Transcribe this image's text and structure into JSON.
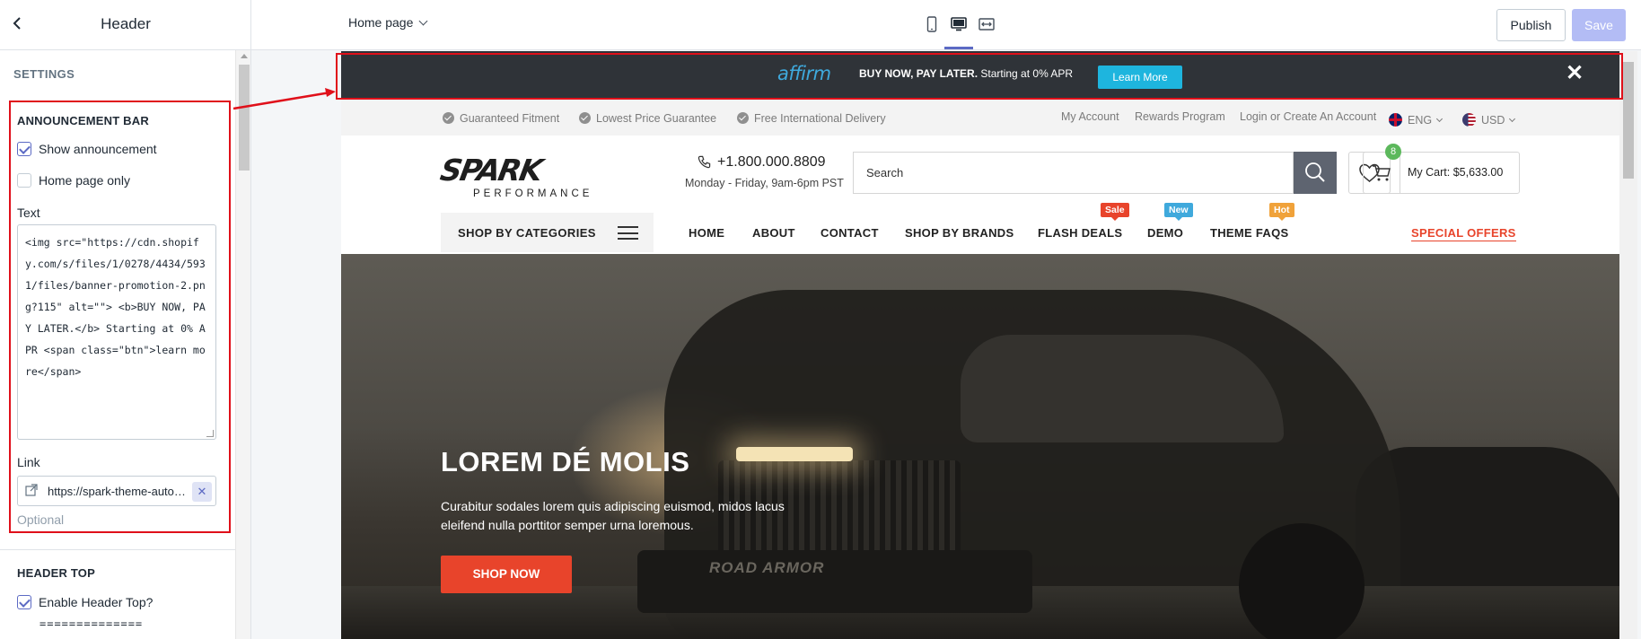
{
  "editor": {
    "sidebar": {
      "title": "Header",
      "settings_label": "SETTINGS",
      "announcement": {
        "title": "ANNOUNCEMENT BAR",
        "show_label": "Show announcement",
        "show_checked": true,
        "home_only_label": "Home page only",
        "home_only_checked": false,
        "text_label": "Text",
        "text_value": "<img src=\"https://cdn.shopify.com/s/files/1/0278/4434/5931/files/banner-promotion-2.png?115\" alt=\"\"> <b>BUY NOW, PAY LATER.</b> Starting at 0% APR <span class=\"btn\">learn more</span>",
        "link_label": "Link",
        "link_value": "https://spark-theme-automotive.myshopify.com",
        "link_help": "Optional"
      },
      "header_top": {
        "title": "HEADER TOP",
        "enable_label": "Enable Header Top?",
        "enable_checked": true,
        "separator_text": "=============="
      }
    },
    "toolbar": {
      "page_select": "Home page",
      "publish_label": "Publish",
      "save_label": "Save"
    }
  },
  "store": {
    "announcement": {
      "logo_text": "affirm",
      "bold_text": "BUY NOW, PAY LATER.",
      "rest_text": " Starting at 0% APR",
      "button_label": "Learn More",
      "close_symbol": "✕"
    },
    "header_top": {
      "left_items": [
        "Guaranteed Fitment",
        "Lowest Price Guarantee",
        "Free International Delivery"
      ],
      "links": [
        "My Account",
        "Rewards Program",
        "Login or Create An Account"
      ],
      "language": "ENG",
      "currency": "USD"
    },
    "header_main": {
      "logo_main": "SPARK",
      "logo_sub": "PERFORMANCE",
      "phone": "+1.800.000.8809",
      "hours": "Monday - Friday, 9am-6pm PST",
      "search_placeholder": "Search",
      "cart_count": "8",
      "cart_label": "My Cart: $5,633.00"
    },
    "nav": {
      "categories_label": "SHOP BY CATEGORIES",
      "items": [
        "HOME",
        "ABOUT",
        "CONTACT",
        "SHOP BY BRANDS",
        "FLASH DEALS",
        "DEMO",
        "THEME FAQS"
      ],
      "tags": [
        "Sale",
        "New",
        "Hot"
      ],
      "special": "SPECIAL OFFERS"
    },
    "hero": {
      "title": "LOREM DÉ MOLIS",
      "description": "Curabitur sodales lorem quis adipiscing euismod, midos lacus eleifend nulla porttitor semper urna loremous.",
      "button_label": "SHOP NOW",
      "bumper_text": "ROAD ARMOR"
    }
  },
  "colors": {
    "accent": "#5c6ac4",
    "highlight_border": "#e0101a",
    "announcement_bg": "#2f3338",
    "affirm_blue": "#1eb5de",
    "brand_orange": "#e8442b",
    "tag_sale": "#e8442b",
    "tag_new": "#3fa9dc",
    "tag_hot": "#f0a23a"
  },
  "icons": [
    "back-arrow-icon",
    "chevron-down-icon",
    "mobile-icon",
    "desktop-icon",
    "fullwidth-icon",
    "external-link-icon",
    "clear-icon",
    "check-circle-icon",
    "uk-flag-icon",
    "us-flag-icon",
    "phone-icon",
    "search-icon",
    "heart-icon",
    "cart-icon",
    "hamburger-icon",
    "close-icon"
  ]
}
